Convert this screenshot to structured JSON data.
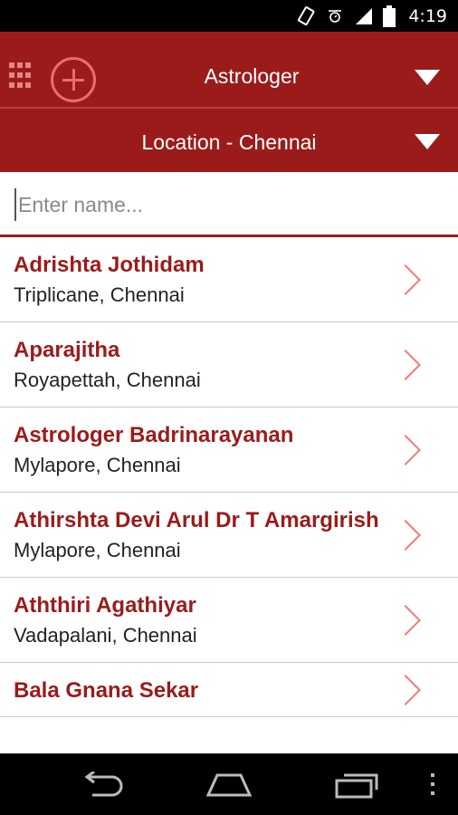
{
  "status_bar": {
    "time": "4:19",
    "icons": [
      "phone-vibrate-icon",
      "alarm-icon",
      "signal-icon",
      "battery-icon"
    ]
  },
  "header": {
    "category": "Astrologer",
    "location": "Location - Chennai"
  },
  "search": {
    "placeholder": "Enter name..."
  },
  "list": {
    "items": [
      {
        "name": "Adrishta Jothidam",
        "location": "Triplicane, Chennai"
      },
      {
        "name": "Aparajitha",
        "location": "Royapettah, Chennai"
      },
      {
        "name": "Astrologer Badrinarayanan",
        "location": "Mylapore, Chennai"
      },
      {
        "name": "Athirshta Devi Arul Dr T Amargirish",
        "location": "Mylapore, Chennai"
      },
      {
        "name": "Aththiri Agathiyar",
        "location": "Vadapalani, Chennai"
      },
      {
        "name": "Bala Gnana Sekar",
        "location": ""
      }
    ]
  },
  "nav_bar": {
    "buttons": [
      "back-icon",
      "home-icon",
      "recent-apps-icon",
      "overflow-menu-icon"
    ]
  },
  "colors": {
    "brand": "#9b1b1b",
    "accent": "#ef7b7b"
  }
}
